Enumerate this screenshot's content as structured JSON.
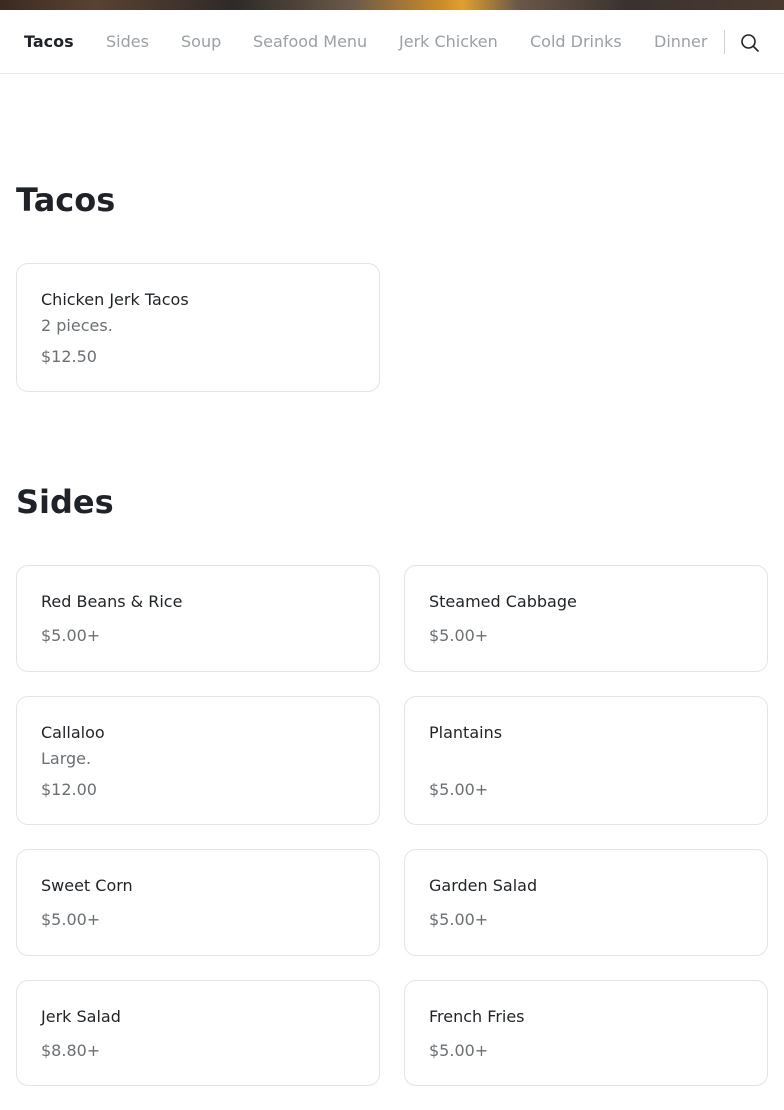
{
  "nav": {
    "items": [
      {
        "label": "Tacos",
        "active": true
      },
      {
        "label": "Sides"
      },
      {
        "label": "Soup"
      },
      {
        "label": "Seafood Menu"
      },
      {
        "label": "Jerk Chicken"
      },
      {
        "label": "Cold Drinks"
      },
      {
        "label": "Dinner"
      }
    ],
    "search_icon": "search-icon"
  },
  "sections": [
    {
      "title": "Tacos",
      "items": [
        {
          "name": "Chicken Jerk Tacos",
          "description": "2 pieces.",
          "price": "$12.50"
        }
      ]
    },
    {
      "title": "Sides",
      "items": [
        {
          "name": "Red Beans & Rice",
          "price": "$5.00+"
        },
        {
          "name": "Steamed Cabbage",
          "price": "$5.00+"
        },
        {
          "name": "Callaloo",
          "description": "Large.",
          "price": "$12.00"
        },
        {
          "name": "Plantains",
          "price": "$5.00+"
        },
        {
          "name": "Sweet Corn",
          "price": "$5.00+"
        },
        {
          "name": "Garden Salad",
          "price": "$5.00+"
        },
        {
          "name": "Jerk Salad",
          "price": "$8.80+"
        },
        {
          "name": "French Fries",
          "price": "$5.00+"
        }
      ]
    }
  ],
  "colors": {
    "text": "#1f2328",
    "muted": "#6b7075",
    "nav_inactive": "#9aa0a6",
    "card_border": "#e2e4e8"
  }
}
